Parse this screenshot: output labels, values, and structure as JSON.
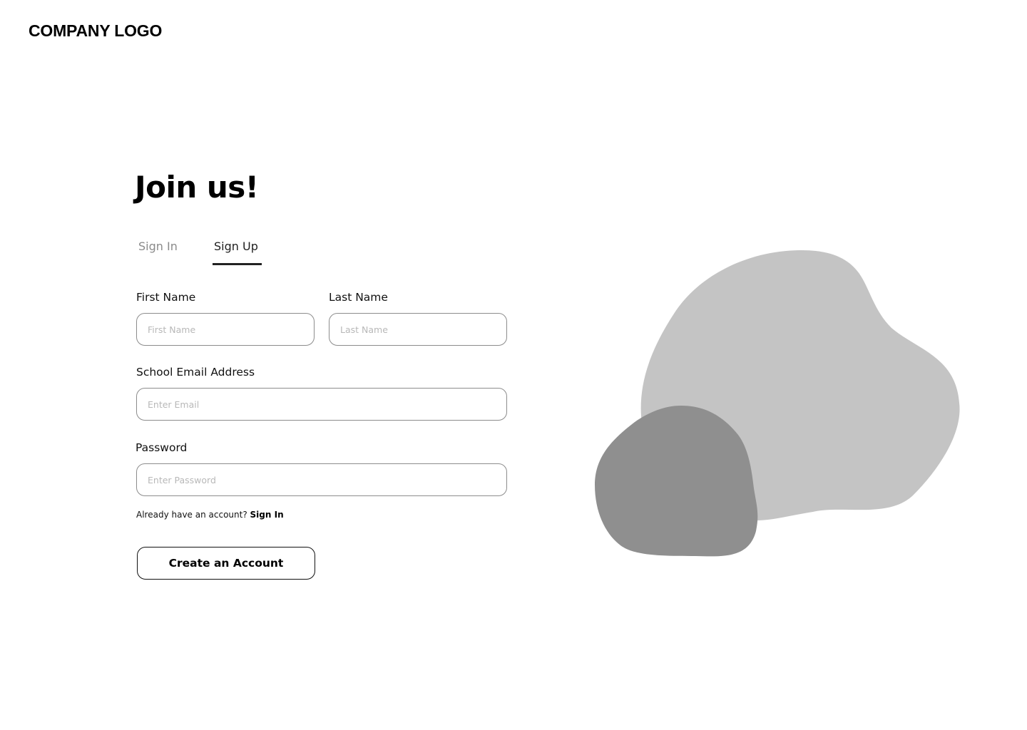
{
  "header": {
    "logo_text": "COMPANY LOGO"
  },
  "form": {
    "heading": "Join us!",
    "tabs": [
      {
        "label": "Sign In",
        "active": false
      },
      {
        "label": "Sign Up",
        "active": true
      }
    ],
    "fields": {
      "first_name": {
        "label": "First Name",
        "placeholder": "First Name",
        "value": ""
      },
      "last_name": {
        "label": "Last Name",
        "placeholder": "Last Name",
        "value": ""
      },
      "email": {
        "label": "School Email Address",
        "placeholder": "Enter Email",
        "value": ""
      },
      "password": {
        "label": "Password",
        "placeholder": "Enter Password",
        "value": ""
      }
    },
    "signin_prompt": {
      "text": "Already have an account?",
      "link_label": "Sign In"
    },
    "submit_label": "Create an Account"
  },
  "illustration": {
    "large_blob_color": "#c4c4c4",
    "small_blob_color": "#8f8f8f"
  }
}
